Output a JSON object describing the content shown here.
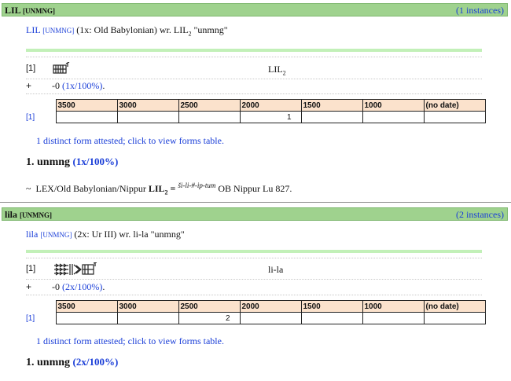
{
  "entries": [
    {
      "headword": "LIL",
      "headword_pos": "[UNMNG]",
      "instances": "(1 instances)",
      "summary_word": "LIL",
      "summary_pos": "[UNMNG]",
      "summary_attest": "(1x: Old Babylonian) wr.",
      "summary_written": "LIL",
      "summary_written_sub": "2",
      "summary_gloss": "\"unmng\"",
      "form_num": "[1]",
      "form_translit": "LIL",
      "form_translit_sub": "2",
      "plus_sign": "+",
      "plus_prefix": "-0",
      "plus_pct": "(1x/100%)",
      "plus_suffix": ".",
      "periods": [
        "3500",
        "3000",
        "2500",
        "2000",
        "1500",
        "1000",
        "(no date)"
      ],
      "row_label": "[1]",
      "counts": [
        "",
        "",
        "",
        "1",
        "",
        "",
        ""
      ],
      "distinct": "1 distinct form attested; click to view forms table.",
      "sense_label": "1. unmng",
      "sense_pct": "(1x/100%)",
      "lex_marker": "~",
      "lex_source": "LEX/Old Babylonian/Nippur",
      "lex_word": "LIL",
      "lex_word_sub": "2",
      "lex_eq": "=",
      "lex_gloss_sup": "ši-li-#-ip-tum",
      "lex_ref": "OB Nippur Lu 827."
    },
    {
      "headword": "lila",
      "headword_pos": "[UNMNG]",
      "instances": "(2 instances)",
      "summary_word": "lila",
      "summary_pos": "[UNMNG]",
      "summary_attest": "(2x: Ur III) wr.",
      "summary_written": "li-la",
      "summary_gloss": "\"unmng\"",
      "form_num": "[1]",
      "form_translit": "li-la",
      "plus_sign": "+",
      "plus_prefix": "-0",
      "plus_pct": "(2x/100%)",
      "plus_suffix": ".",
      "periods": [
        "3500",
        "3000",
        "2500",
        "2000",
        "1500",
        "1000",
        "(no date)"
      ],
      "row_label": "[1]",
      "counts": [
        "",
        "",
        "2",
        "",
        "",
        "",
        ""
      ],
      "distinct": "1 distinct form attested; click to view forms table.",
      "sense_label": "1. unmng",
      "sense_pct": "(2x/100%)"
    }
  ],
  "colors": {
    "header_bg": "#9fd28e",
    "link": "#1a3ed8",
    "period_bg": "#fbe2cc",
    "green_bar": "#c2f0b8"
  }
}
